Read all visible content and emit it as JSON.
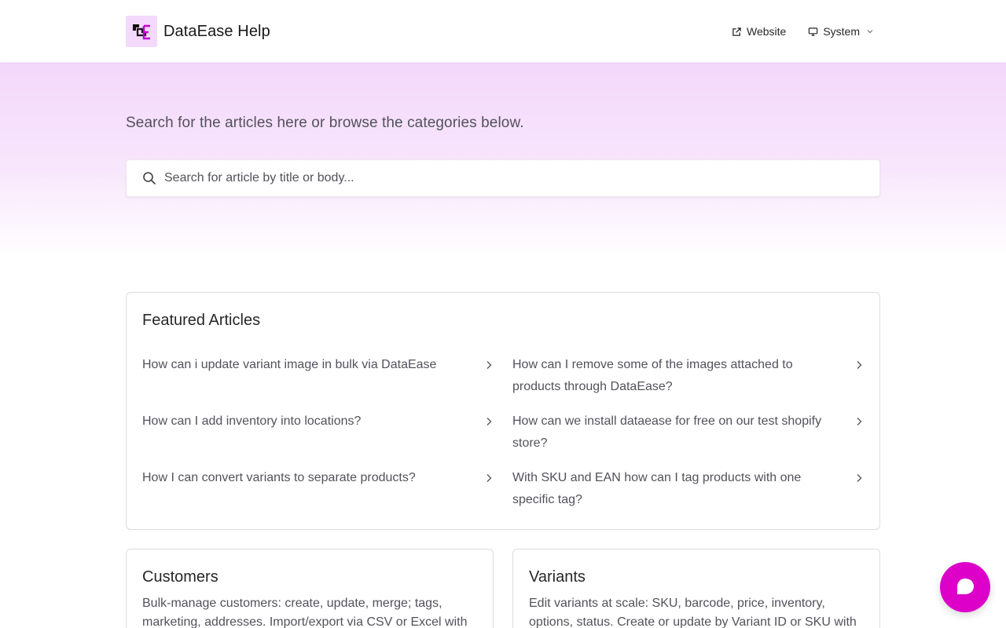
{
  "header": {
    "brand_name": "DataEase Help",
    "nav": [
      {
        "label": "Website",
        "icon": "external-link-icon"
      },
      {
        "label": "System",
        "icon": "monitor-icon"
      }
    ]
  },
  "hero": {
    "text": "Search for the articles here or browse the categories below.",
    "search_placeholder": "Search for article by title or body..."
  },
  "featured": {
    "title": "Featured Articles",
    "articles": [
      "How can i update variant image in bulk via DataEase",
      "How can I remove some of the images attached to products through DataEase?",
      "How can I add inventory into locations?",
      "How can we install dataease for free on our test shopify store?",
      "How I can convert variants to separate products?",
      "With SKU and EAN how can I tag products with one specific tag?"
    ]
  },
  "categories": [
    {
      "title": "Customers",
      "description": "Bulk-manage customers: create, update, merge; tags, marketing, addresses. Import/export via CSV or Excel with"
    },
    {
      "title": "Variants",
      "description": "Edit variants at scale: SKU, barcode, price, inventory, options, status. Create or update by Variant ID or SKU with"
    }
  ],
  "colors": {
    "accent": "#dc00c8",
    "logo_bg": "#f3d9fb",
    "hero_gradient_top": "#f3d7fb"
  },
  "chat": {
    "icon": "chat-bubble-icon"
  }
}
